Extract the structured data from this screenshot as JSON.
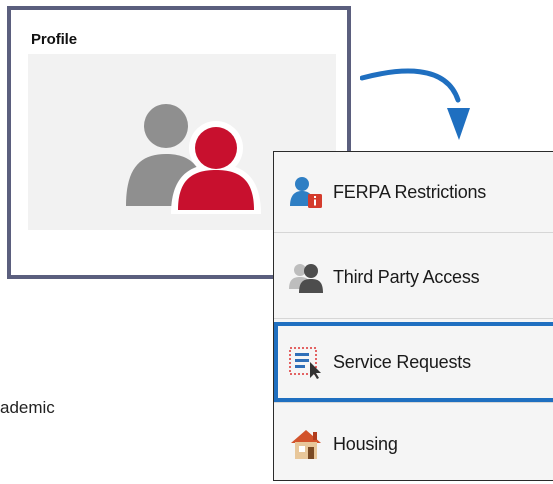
{
  "profile_tile": {
    "title": "Profile",
    "icon": "two-people-profile-icon"
  },
  "backdrop": {
    "text": "ademic"
  },
  "colors": {
    "tile_border": "#5b5f7e",
    "person_gray": "#8f8f8f",
    "person_red": "#c8102e",
    "arrow_blue": "#1f6fc0",
    "selected_border": "#1f6fc0"
  },
  "menu": {
    "items": [
      {
        "label": "FERPA Restrictions",
        "icon": "ferpa-lock-person-icon"
      },
      {
        "label": "Third Party Access",
        "icon": "third-party-people-icon"
      },
      {
        "label": "Service Requests",
        "icon": "service-request-list-icon",
        "selected": true
      },
      {
        "label": "Housing",
        "icon": "house-icon"
      }
    ]
  }
}
